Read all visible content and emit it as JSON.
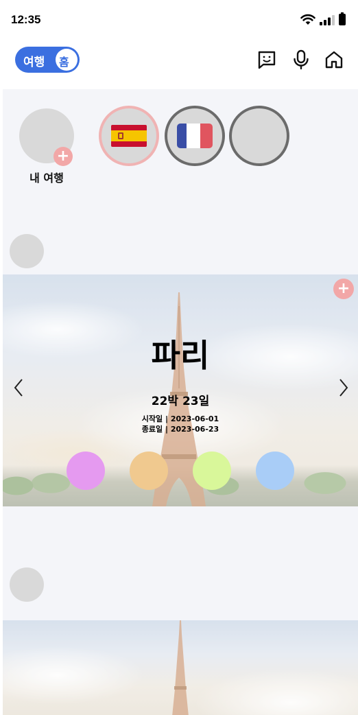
{
  "status_bar": {
    "time": "12:35"
  },
  "header": {
    "toggle_travel_label": "여행",
    "toggle_home_label": "홈"
  },
  "trips_strip": {
    "add_label": "내 여행",
    "add_symbol": "+",
    "trips": [
      {
        "flag": "spain-flag",
        "selected": true
      },
      {
        "flag": "france-flag",
        "selected": false
      },
      {
        "flag": "",
        "selected": false
      }
    ]
  },
  "card": {
    "city": "파리",
    "duration": "22박 23일",
    "start_date": "시작일 | 2023-06-01",
    "end_date": "종료일 | 2023-06-23",
    "add_symbol": "+",
    "color_dots": [
      "#e59af0",
      "#f0c98f",
      "#d9f79a",
      "#a9cdf7"
    ]
  },
  "colors": {
    "accent": "#3b6fe0",
    "badge": "#f2a7a7",
    "selected_ring": "#f0b3b3",
    "ring": "#6b6b6b",
    "placeholder": "#d9d9d9"
  }
}
